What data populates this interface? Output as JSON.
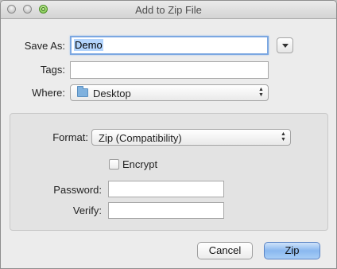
{
  "window": {
    "title": "Add to Zip File"
  },
  "form": {
    "save_as_label": "Save As:",
    "save_as_value": "Demo",
    "tags_label": "Tags:",
    "tags_value": "",
    "where_label": "Where:",
    "where_value": "Desktop"
  },
  "options": {
    "format_label": "Format:",
    "format_value": "Zip (Compatibility)",
    "encrypt_label": "Encrypt",
    "encrypt_checked": false,
    "password_label": "Password:",
    "password_value": "",
    "verify_label": "Verify:",
    "verify_value": ""
  },
  "buttons": {
    "cancel": "Cancel",
    "zip": "Zip"
  },
  "icons": {
    "traffic_lights": [
      "close-icon",
      "minimize-icon",
      "zoom-icon"
    ],
    "where_icon": "folder-icon",
    "disclosure_icon": "chevron-down-icon",
    "popup_icon": "up-down-arrows-icon"
  },
  "colors": {
    "focus_ring": "#7ba7e1",
    "default_button": "#8ab8ef",
    "folder": "#7fb1de"
  }
}
